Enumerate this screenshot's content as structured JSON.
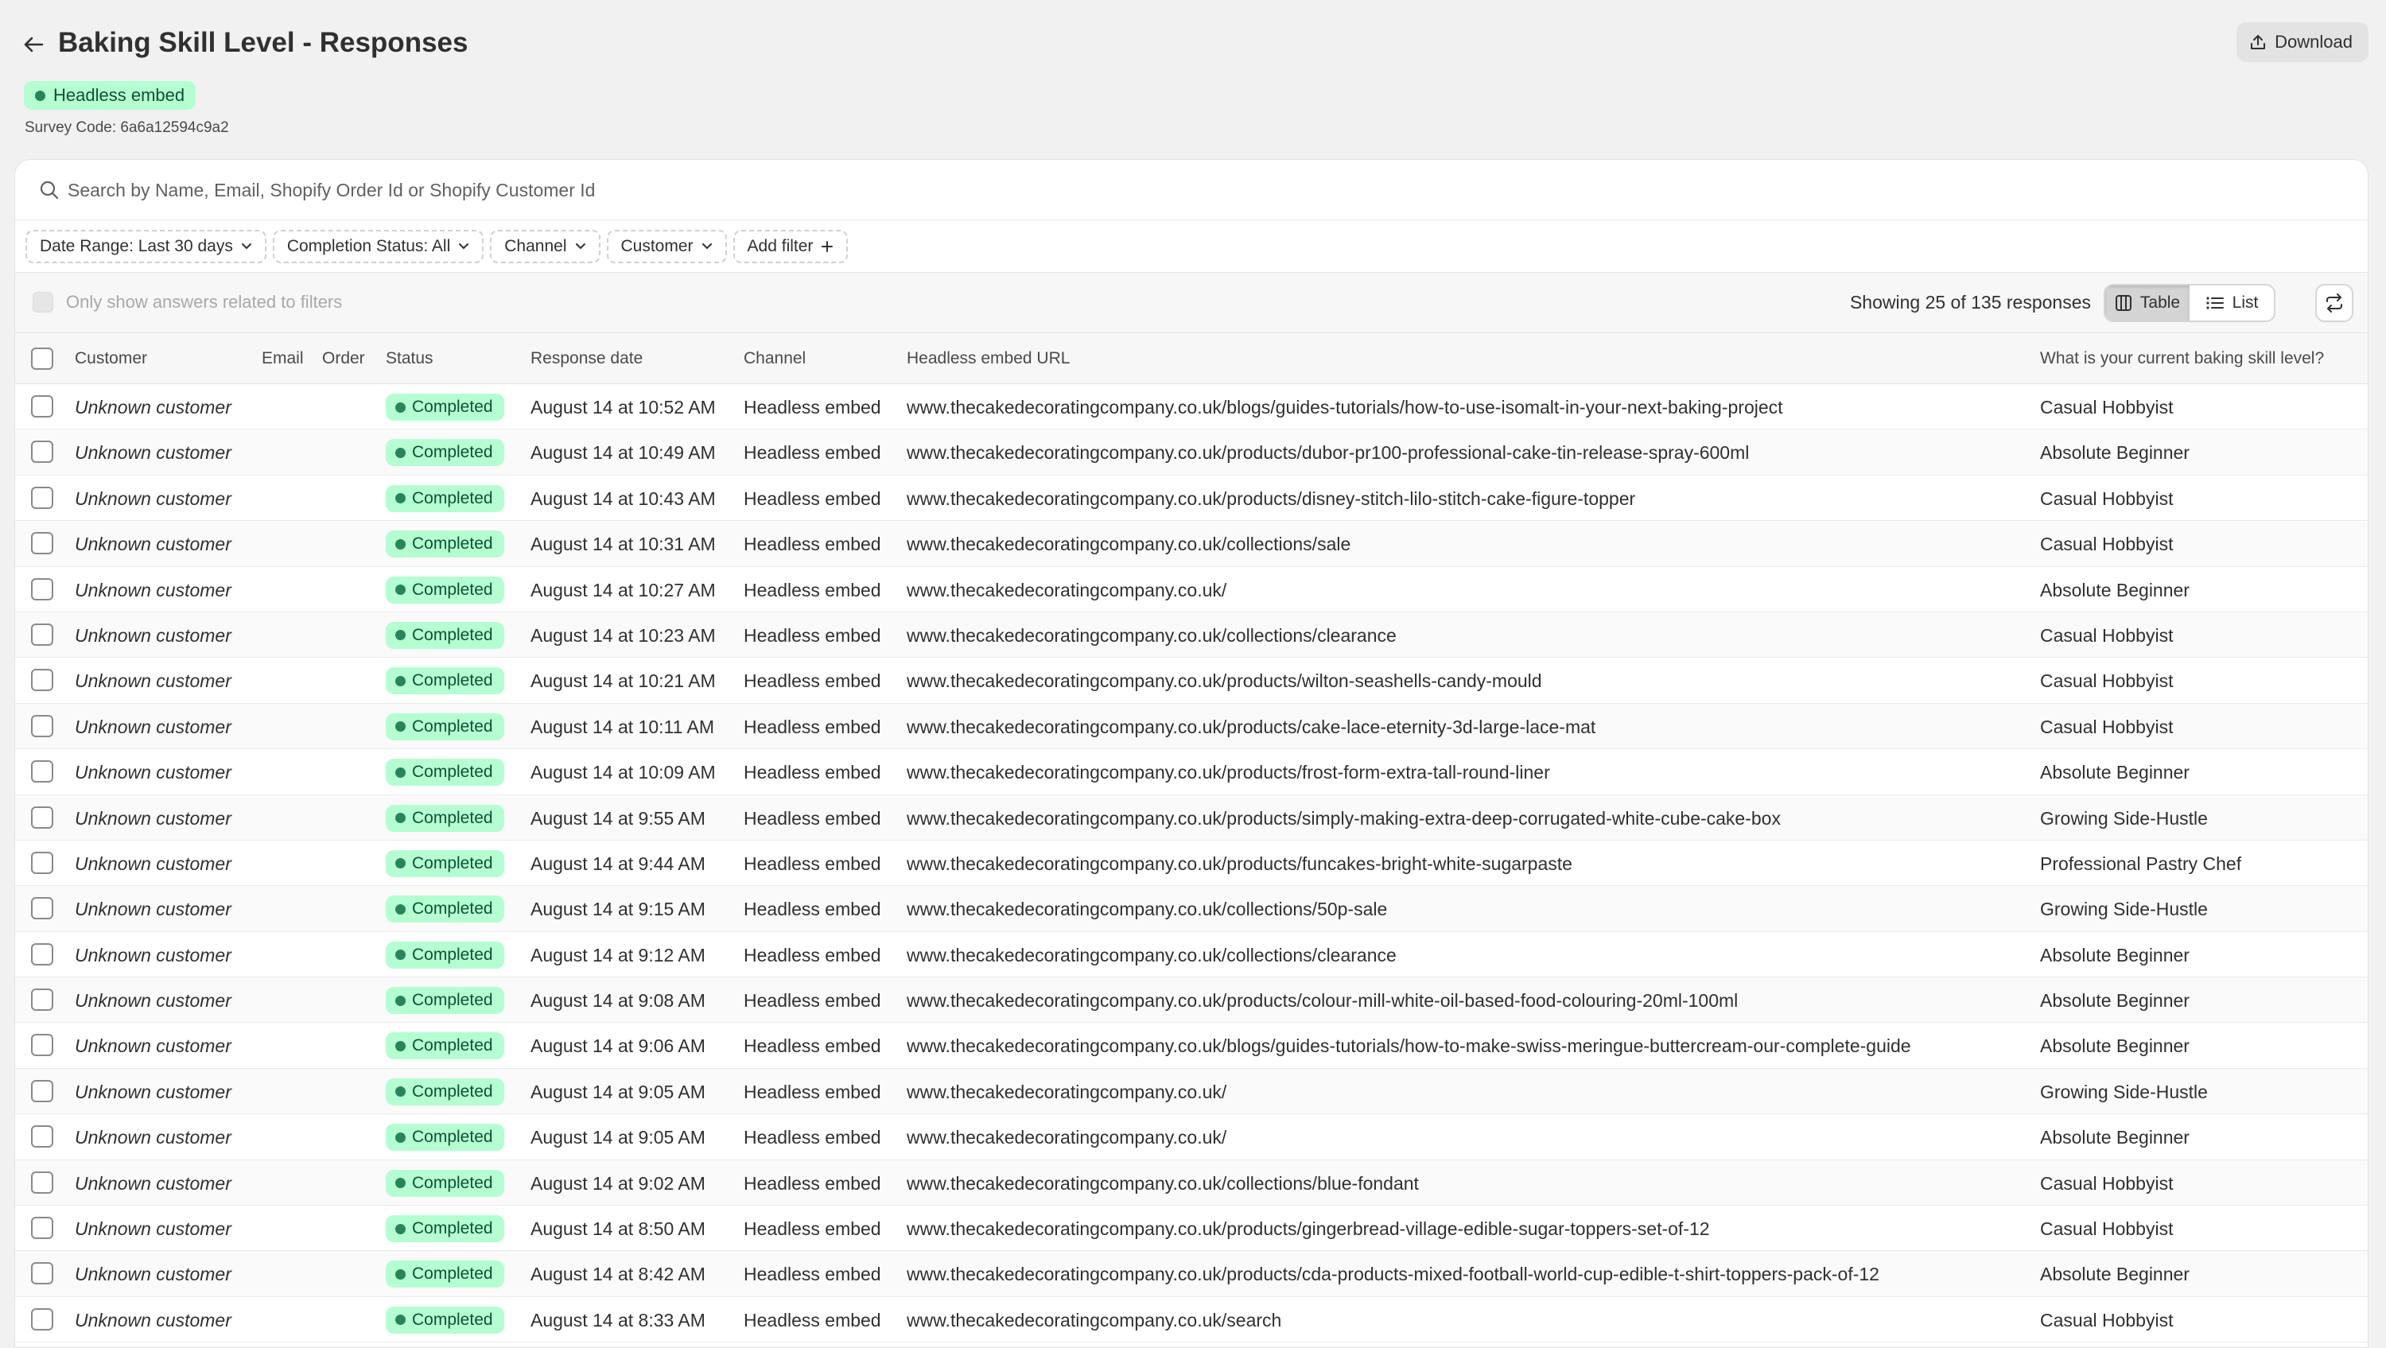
{
  "header": {
    "title": "Baking Skill Level - Responses",
    "download_label": "Download",
    "channel_badge": "Headless embed",
    "survey_code": "Survey Code: 6a6a12594c9a2"
  },
  "search": {
    "placeholder": "Search by Name, Email, Shopify Order Id or Shopify Customer Id"
  },
  "filters": [
    {
      "label": "Date Range: Last 30 days",
      "icon": "chevron-down-icon"
    },
    {
      "label": "Completion Status: All",
      "icon": "chevron-down-icon"
    },
    {
      "label": "Channel",
      "icon": "chevron-down-icon"
    },
    {
      "label": "Customer",
      "icon": "chevron-down-icon"
    },
    {
      "label": "Add filter",
      "icon": "plus-icon"
    }
  ],
  "toolbar": {
    "only_show_label": "Only show answers related to filters",
    "showing": "Showing 25 of 135 responses",
    "view_table": "Table",
    "view_list": "List"
  },
  "table": {
    "columns": {
      "customer": "Customer",
      "email": "Email",
      "order": "Order",
      "status": "Status",
      "response_date": "Response date",
      "channel": "Channel",
      "url": "Headless embed URL",
      "answer": "What is your current baking skill level?"
    },
    "rows": [
      {
        "customer": "Unknown customer",
        "status": "Completed",
        "date": "August 14 at 10:52 AM",
        "channel": "Headless embed",
        "url": "www.thecakedecoratingcompany.co.uk/blogs/guides-tutorials/how-to-use-isomalt-in-your-next-baking-project",
        "answer": "Casual Hobbyist"
      },
      {
        "customer": "Unknown customer",
        "status": "Completed",
        "date": "August 14 at 10:49 AM",
        "channel": "Headless embed",
        "url": "www.thecakedecoratingcompany.co.uk/products/dubor-pr100-professional-cake-tin-release-spray-600ml",
        "answer": "Absolute Beginner"
      },
      {
        "customer": "Unknown customer",
        "status": "Completed",
        "date": "August 14 at 10:43 AM",
        "channel": "Headless embed",
        "url": "www.thecakedecoratingcompany.co.uk/products/disney-stitch-lilo-stitch-cake-figure-topper",
        "answer": "Casual Hobbyist"
      },
      {
        "customer": "Unknown customer",
        "status": "Completed",
        "date": "August 14 at 10:31 AM",
        "channel": "Headless embed",
        "url": "www.thecakedecoratingcompany.co.uk/collections/sale",
        "answer": "Casual Hobbyist"
      },
      {
        "customer": "Unknown customer",
        "status": "Completed",
        "date": "August 14 at 10:27 AM",
        "channel": "Headless embed",
        "url": "www.thecakedecoratingcompany.co.uk/",
        "answer": "Absolute Beginner"
      },
      {
        "customer": "Unknown customer",
        "status": "Completed",
        "date": "August 14 at 10:23 AM",
        "channel": "Headless embed",
        "url": "www.thecakedecoratingcompany.co.uk/collections/clearance",
        "answer": "Casual Hobbyist"
      },
      {
        "customer": "Unknown customer",
        "status": "Completed",
        "date": "August 14 at 10:21 AM",
        "channel": "Headless embed",
        "url": "www.thecakedecoratingcompany.co.uk/products/wilton-seashells-candy-mould",
        "answer": "Casual Hobbyist"
      },
      {
        "customer": "Unknown customer",
        "status": "Completed",
        "date": "August 14 at 10:11 AM",
        "channel": "Headless embed",
        "url": "www.thecakedecoratingcompany.co.uk/products/cake-lace-eternity-3d-large-lace-mat",
        "answer": "Casual Hobbyist"
      },
      {
        "customer": "Unknown customer",
        "status": "Completed",
        "date": "August 14 at 10:09 AM",
        "channel": "Headless embed",
        "url": "www.thecakedecoratingcompany.co.uk/products/frost-form-extra-tall-round-liner",
        "answer": "Absolute Beginner"
      },
      {
        "customer": "Unknown customer",
        "status": "Completed",
        "date": "August 14 at 9:55 AM",
        "channel": "Headless embed",
        "url": "www.thecakedecoratingcompany.co.uk/products/simply-making-extra-deep-corrugated-white-cube-cake-box",
        "answer": "Growing Side-Hustle"
      },
      {
        "customer": "Unknown customer",
        "status": "Completed",
        "date": "August 14 at 9:44 AM",
        "channel": "Headless embed",
        "url": "www.thecakedecoratingcompany.co.uk/products/funcakes-bright-white-sugarpaste",
        "answer": "Professional Pastry Chef"
      },
      {
        "customer": "Unknown customer",
        "status": "Completed",
        "date": "August 14 at 9:15 AM",
        "channel": "Headless embed",
        "url": "www.thecakedecoratingcompany.co.uk/collections/50p-sale",
        "answer": "Growing Side-Hustle"
      },
      {
        "customer": "Unknown customer",
        "status": "Completed",
        "date": "August 14 at 9:12 AM",
        "channel": "Headless embed",
        "url": "www.thecakedecoratingcompany.co.uk/collections/clearance",
        "answer": "Absolute Beginner"
      },
      {
        "customer": "Unknown customer",
        "status": "Completed",
        "date": "August 14 at 9:08 AM",
        "channel": "Headless embed",
        "url": "www.thecakedecoratingcompany.co.uk/products/colour-mill-white-oil-based-food-colouring-20ml-100ml",
        "answer": "Absolute Beginner"
      },
      {
        "customer": "Unknown customer",
        "status": "Completed",
        "date": "August 14 at 9:06 AM",
        "channel": "Headless embed",
        "url": "www.thecakedecoratingcompany.co.uk/blogs/guides-tutorials/how-to-make-swiss-meringue-buttercream-our-complete-guide",
        "answer": "Absolute Beginner"
      },
      {
        "customer": "Unknown customer",
        "status": "Completed",
        "date": "August 14 at 9:05 AM",
        "channel": "Headless embed",
        "url": "www.thecakedecoratingcompany.co.uk/",
        "answer": "Growing Side-Hustle"
      },
      {
        "customer": "Unknown customer",
        "status": "Completed",
        "date": "August 14 at 9:05 AM",
        "channel": "Headless embed",
        "url": "www.thecakedecoratingcompany.co.uk/",
        "answer": "Absolute Beginner"
      },
      {
        "customer": "Unknown customer",
        "status": "Completed",
        "date": "August 14 at 9:02 AM",
        "channel": "Headless embed",
        "url": "www.thecakedecoratingcompany.co.uk/collections/blue-fondant",
        "answer": "Casual Hobbyist"
      },
      {
        "customer": "Unknown customer",
        "status": "Completed",
        "date": "August 14 at 8:50 AM",
        "channel": "Headless embed",
        "url": "www.thecakedecoratingcompany.co.uk/products/gingerbread-village-edible-sugar-toppers-set-of-12",
        "answer": "Casual Hobbyist"
      },
      {
        "customer": "Unknown customer",
        "status": "Completed",
        "date": "August 14 at 8:42 AM",
        "channel": "Headless embed",
        "url": "www.thecakedecoratingcompany.co.uk/products/cda-products-mixed-football-world-cup-edible-t-shirt-toppers-pack-of-12",
        "answer": "Absolute Beginner"
      },
      {
        "customer": "Unknown customer",
        "status": "Completed",
        "date": "August 14 at 8:33 AM",
        "channel": "Headless embed",
        "url": "www.thecakedecoratingcompany.co.uk/search",
        "answer": "Casual Hobbyist"
      }
    ]
  },
  "colors": {
    "badge_bg": "#b4fed2",
    "badge_text": "#0c5132",
    "badge_dot": "#29845a",
    "page_bg": "#f1f1f1"
  }
}
